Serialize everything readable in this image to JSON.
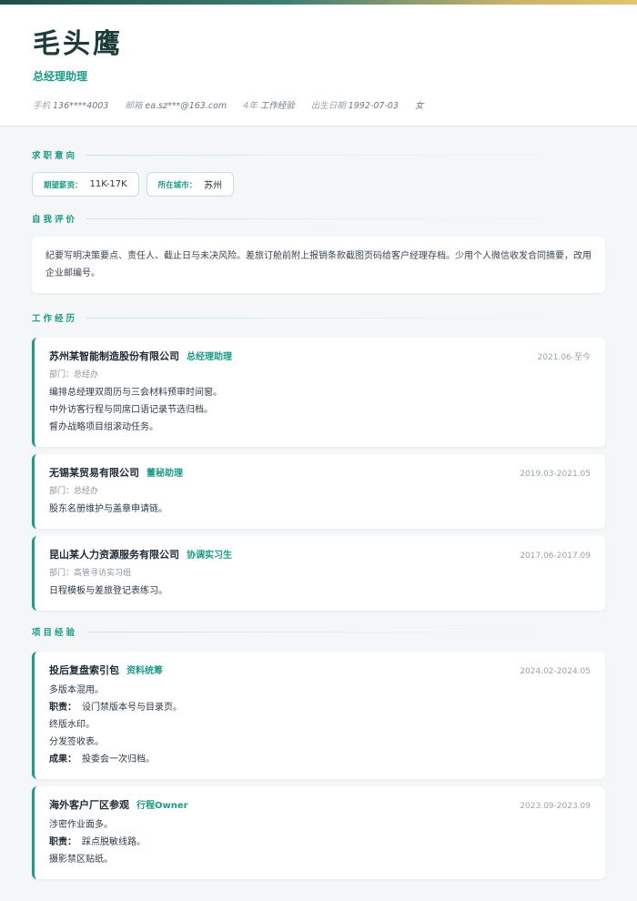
{
  "header": {
    "name": "毛头鹰",
    "title": "总经理助理",
    "meta": [
      {
        "key": "手机",
        "value": "136****4003"
      },
      {
        "key": "邮箱",
        "value": "ea.sz***@163.com"
      },
      {
        "key": "4年",
        "value": "工作经验"
      },
      {
        "key": "出生日期",
        "value": "1992-07-03"
      },
      {
        "key": "",
        "value": "女"
      }
    ]
  },
  "sections": {
    "intent": "求职意向",
    "summary": "自我评价",
    "work": "工作经历",
    "projects": "项目经验"
  },
  "intent": {
    "salary_label": "期望薪资：",
    "salary": "11K-17K",
    "city_label": "所在城市：",
    "city": "苏州"
  },
  "summary": "纪要写明决策要点、责任人、截止日与未决风险。差旅订舱前附上报销条款截图页码给客户经理存档。少用个人微信收发合同摘要，改用企业邮编号。",
  "work": [
    {
      "company": "苏州某智能制造股份有限公司",
      "role": "总经理助理",
      "date": "2021.06-至今",
      "dept": "部门：总经办",
      "lines": [
        "编排总经理双周历与三会材料预审时间窗。",
        "中外访客行程与同席口语记录节选归档。",
        "督办战略项目组滚动任务。"
      ]
    },
    {
      "company": "无锡某贸易有限公司",
      "role": "董秘助理",
      "date": "2019.03-2021.05",
      "dept": "部门：总经办",
      "lines": [
        "股东名册维护与盖章申请链。"
      ]
    },
    {
      "company": "昆山某人力资源服务有限公司",
      "role": "协调实习生",
      "date": "2017.06-2017.09",
      "dept": "部门：高管寻访实习组",
      "lines": [
        "日程模板与差旅登记表练习。"
      ]
    }
  ],
  "projects": [
    {
      "name": "投后复盘索引包",
      "role": "资料统筹",
      "date": "2024.02-2024.05",
      "desc": "多版本混用。",
      "duty_label": "职责：",
      "duty": "设门禁版本号与目录页。",
      "extra": [
        "终版水印。",
        "分发签收表。"
      ],
      "result_label": "成果：",
      "result": "投委会一次归档。"
    },
    {
      "name": "海外客户厂区参观",
      "role": "行程Owner",
      "date": "2023.09-2023.09",
      "desc": "涉密作业面多。",
      "duty_label": "职责：",
      "duty": "踩点脱敏线路。",
      "extra": [
        "摄影禁区贴纸。"
      ]
    }
  ]
}
